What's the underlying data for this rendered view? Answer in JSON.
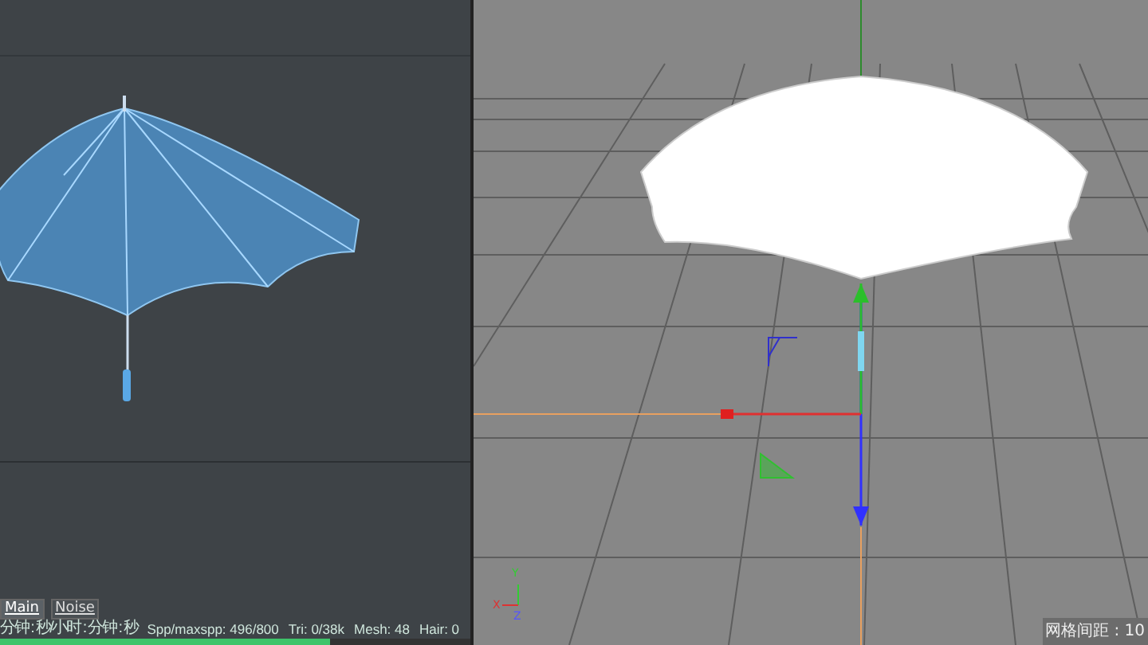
{
  "render_view": {
    "tabs": [
      {
        "label": "Main",
        "selected": true
      },
      {
        "label": "Noise",
        "selected": false
      }
    ],
    "status": [
      "分钟 : 秒/小时 : 分钟 : 秒",
      "Spp/maxspp: 496/800",
      "Tri: 0/38k",
      "Mesh: 48",
      "Hair: 0"
    ],
    "progress": {
      "level": 0.7
    }
  },
  "viewport": {
    "axis_labels": [
      "Y",
      "X",
      "Z"
    ],
    "grid_spacing": "网格间距 : 10"
  }
}
